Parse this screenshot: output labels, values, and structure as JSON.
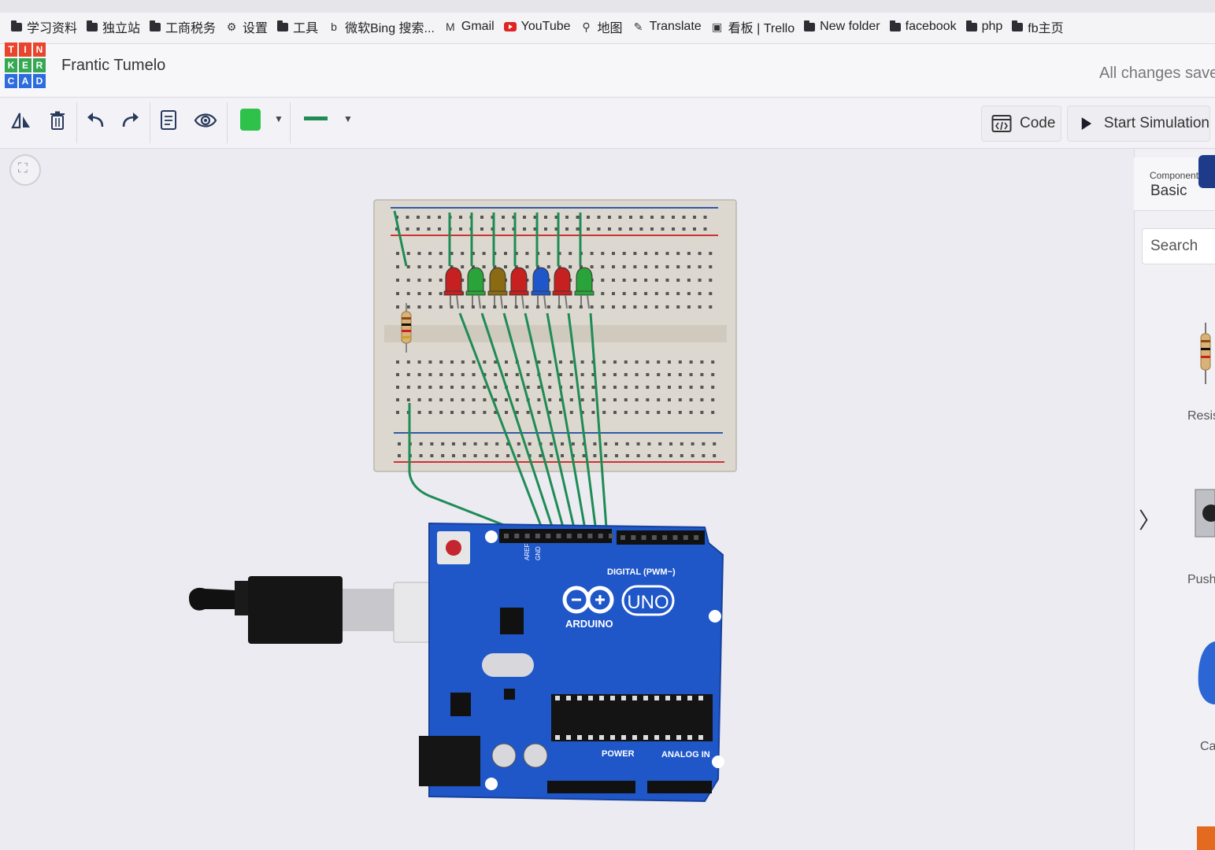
{
  "bookmarks": [
    {
      "label": "学习资料",
      "icon": "folder-icon"
    },
    {
      "label": "独立站",
      "icon": "folder-icon"
    },
    {
      "label": "工商税务",
      "icon": "folder-icon"
    },
    {
      "label": "设置",
      "icon": "gear-icon"
    },
    {
      "label": "工具",
      "icon": "folder-icon"
    },
    {
      "label": "微软Bing 搜索...",
      "icon": "bing-icon"
    },
    {
      "label": "Gmail",
      "icon": "gmail-icon"
    },
    {
      "label": "YouTube",
      "icon": "youtube-icon"
    },
    {
      "label": "地图",
      "icon": "map-pin-icon"
    },
    {
      "label": "Translate",
      "icon": "translate-icon"
    },
    {
      "label": "看板 | Trello",
      "icon": "trello-icon"
    },
    {
      "label": "New folder",
      "icon": "folder-icon"
    },
    {
      "label": "facebook",
      "icon": "folder-icon"
    },
    {
      "label": "php",
      "icon": "folder-icon"
    },
    {
      "label": "fb主页",
      "icon": "folder-icon"
    }
  ],
  "app": {
    "logo_letters": [
      "T",
      "I",
      "N",
      "K",
      "E",
      "R",
      "C",
      "A",
      "D"
    ],
    "logo_colors": [
      "#e8452c",
      "#e8452c",
      "#e8452c",
      "#35a853",
      "#35a853",
      "#35a853",
      "#2d6cdf",
      "#2d6cdf",
      "#2d6cdf"
    ],
    "project_title": "Frantic Tumelo",
    "save_status": "All changes save"
  },
  "toolbar": {
    "tools": [
      "rotate-icon",
      "delete-icon",
      "undo-icon",
      "redo-icon",
      "notes-icon",
      "visibility-icon"
    ],
    "wire_color": "#2fc24a",
    "code_label": "Code",
    "start_label": "Start Simulation"
  },
  "circuit": {
    "board": "ARDUINO",
    "board_model": "UNO",
    "digital_label": "DIGITAL (PWM~)",
    "power_label": "POWER",
    "analog_label": "ANALOG IN",
    "aref_label": "AREF",
    "gnd_label": "GND",
    "led_colors": [
      "#c62020",
      "#2aa43a",
      "#8a6a12",
      "#c62020",
      "#1f56c9",
      "#c62020",
      "#2aa43a"
    ],
    "wire_color": "#1f8b55"
  },
  "panel": {
    "components_label": "Components",
    "components_value": "Basic",
    "search_placeholder": "Search",
    "items": [
      "Resistor",
      "Pushbutton",
      "Capacitor"
    ]
  }
}
